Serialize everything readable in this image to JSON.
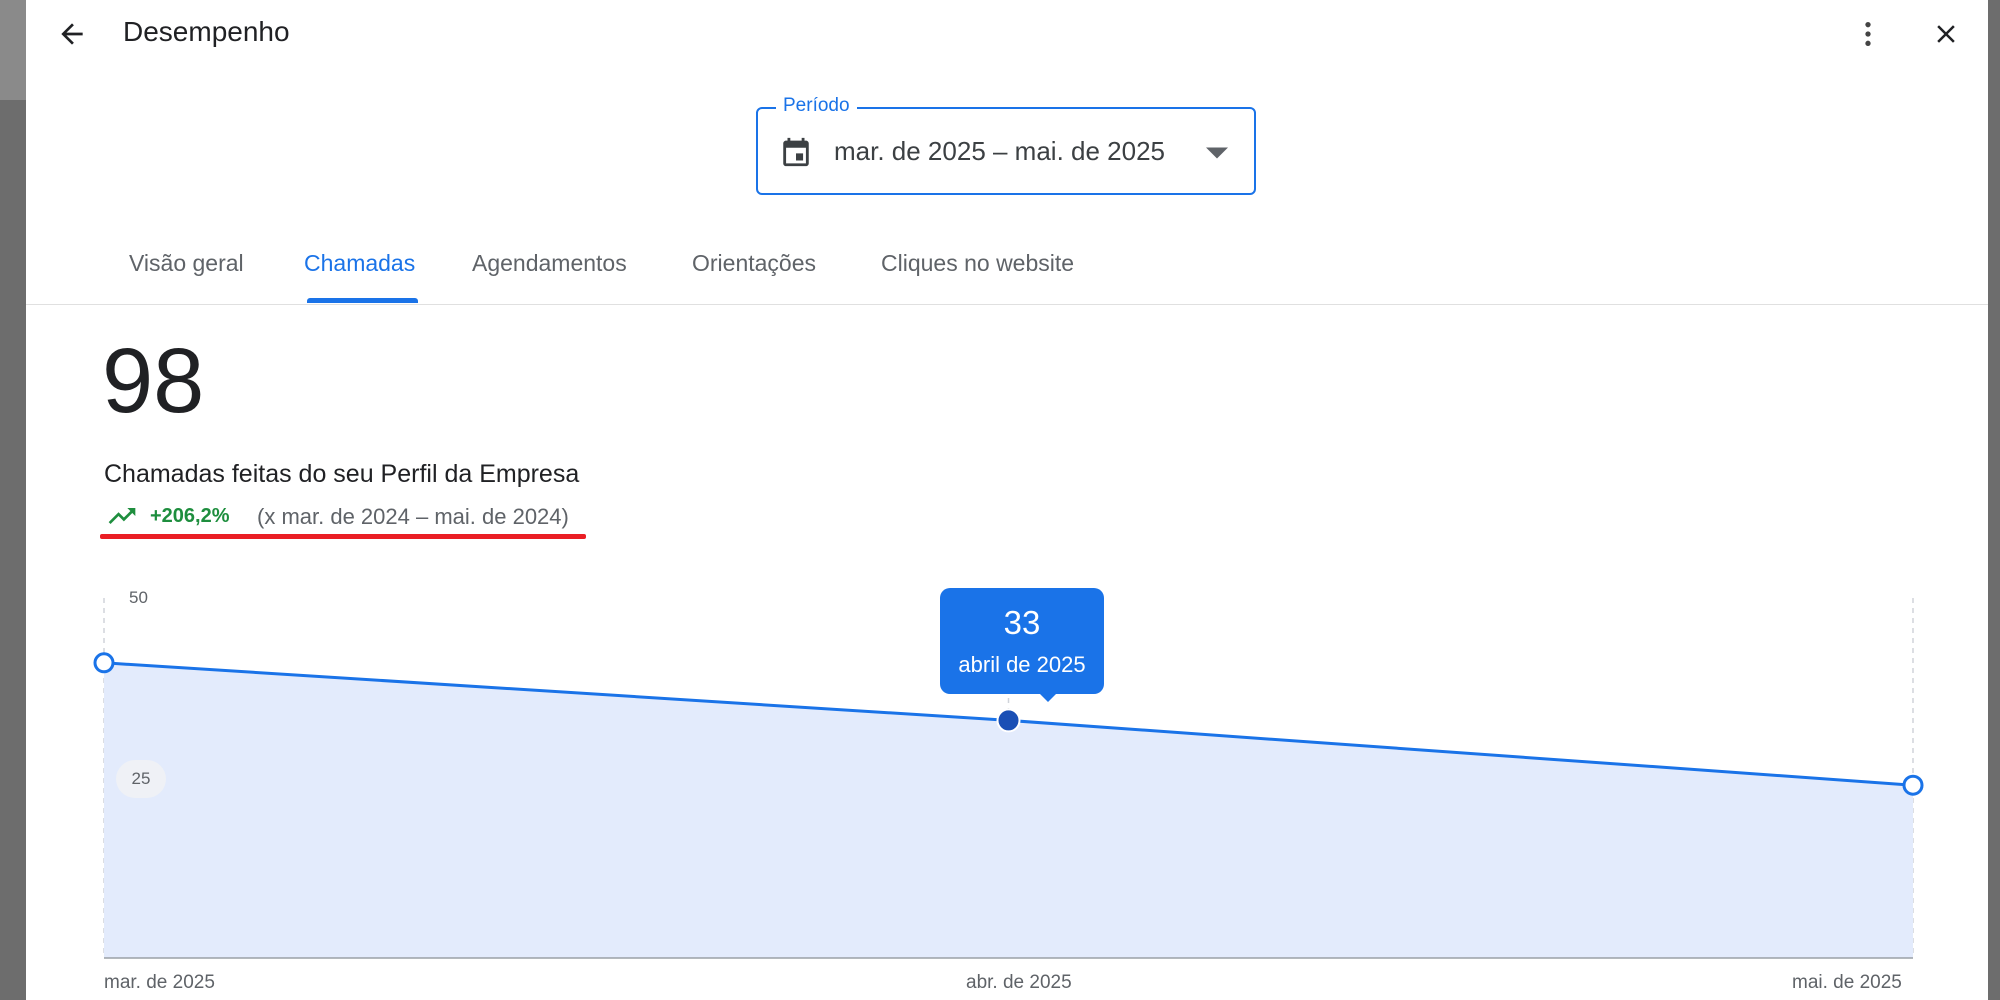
{
  "header": {
    "title": "Desempenho",
    "back_icon": "arrow-back-icon",
    "more_icon": "more-vert-icon",
    "close_icon": "close-icon"
  },
  "period": {
    "label": "Período",
    "value": "mar. de 2025 – mai. de 2025",
    "icon": "calendar-icon"
  },
  "tabs": [
    {
      "label": "Visão geral",
      "active": false
    },
    {
      "label": "Chamadas",
      "active": true
    },
    {
      "label": "Agendamentos",
      "active": false
    },
    {
      "label": "Orientações",
      "active": false
    },
    {
      "label": "Cliques no website",
      "active": false
    }
  ],
  "metric": {
    "value": "98",
    "label": "Chamadas feitas do seu Perfil da Empresa",
    "trend_value": "+206,2%",
    "trend_compare": "(x mar. de 2024 – mai. de 2024)",
    "trend_icon": "trending-up-icon"
  },
  "colors": {
    "accent": "#1a73e8",
    "positive": "#1e8e3e",
    "highlight_underline": "#ea1e24",
    "area_fill": "#e3ebfc"
  },
  "tooltip": {
    "value": "33",
    "date": "abril de 2025"
  },
  "chart_data": {
    "type": "area",
    "categories": [
      "mar. de 2025",
      "abr. de 2025",
      "mai. de 2025"
    ],
    "values": [
      41,
      33,
      24
    ],
    "ylim": [
      0,
      50
    ],
    "yticks": [
      "50",
      "25"
    ],
    "selected_index": 1,
    "grid": "vertical-dashed"
  }
}
